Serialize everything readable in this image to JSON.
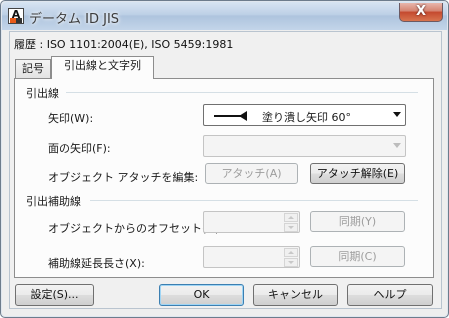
{
  "window": {
    "title": "データム ID JIS",
    "close_glyph": "X"
  },
  "history": "履歴 : ISO 1101:2004(E), ISO 5459:1981",
  "tabs": [
    {
      "label": "記号"
    },
    {
      "label": "引出線と文字列"
    }
  ],
  "leader_group": {
    "title": "引出線",
    "arrow_label": "矢印(W):",
    "arrow_value": "塗り潰し矢印 60°",
    "face_arrow_label": "面の矢印(F):",
    "face_arrow_value": "",
    "attach_label": "オブジェクト アタッチを編集:",
    "attach_button": "アタッチ(A)",
    "detach_button": "アタッチ解除(E)"
  },
  "extension_group": {
    "title": "引出補助線",
    "offset_label": "オブジェクトからのオフセット(O):",
    "offset_value": "",
    "sync1_button": "同期(Y)",
    "extend_label": "補助線延長長さ(X):",
    "extend_value": "",
    "sync2_button": "同期(C)"
  },
  "footer": {
    "settings": "設定(S)...",
    "ok": "OK",
    "cancel": "キャンセル",
    "help": "ヘルプ"
  }
}
